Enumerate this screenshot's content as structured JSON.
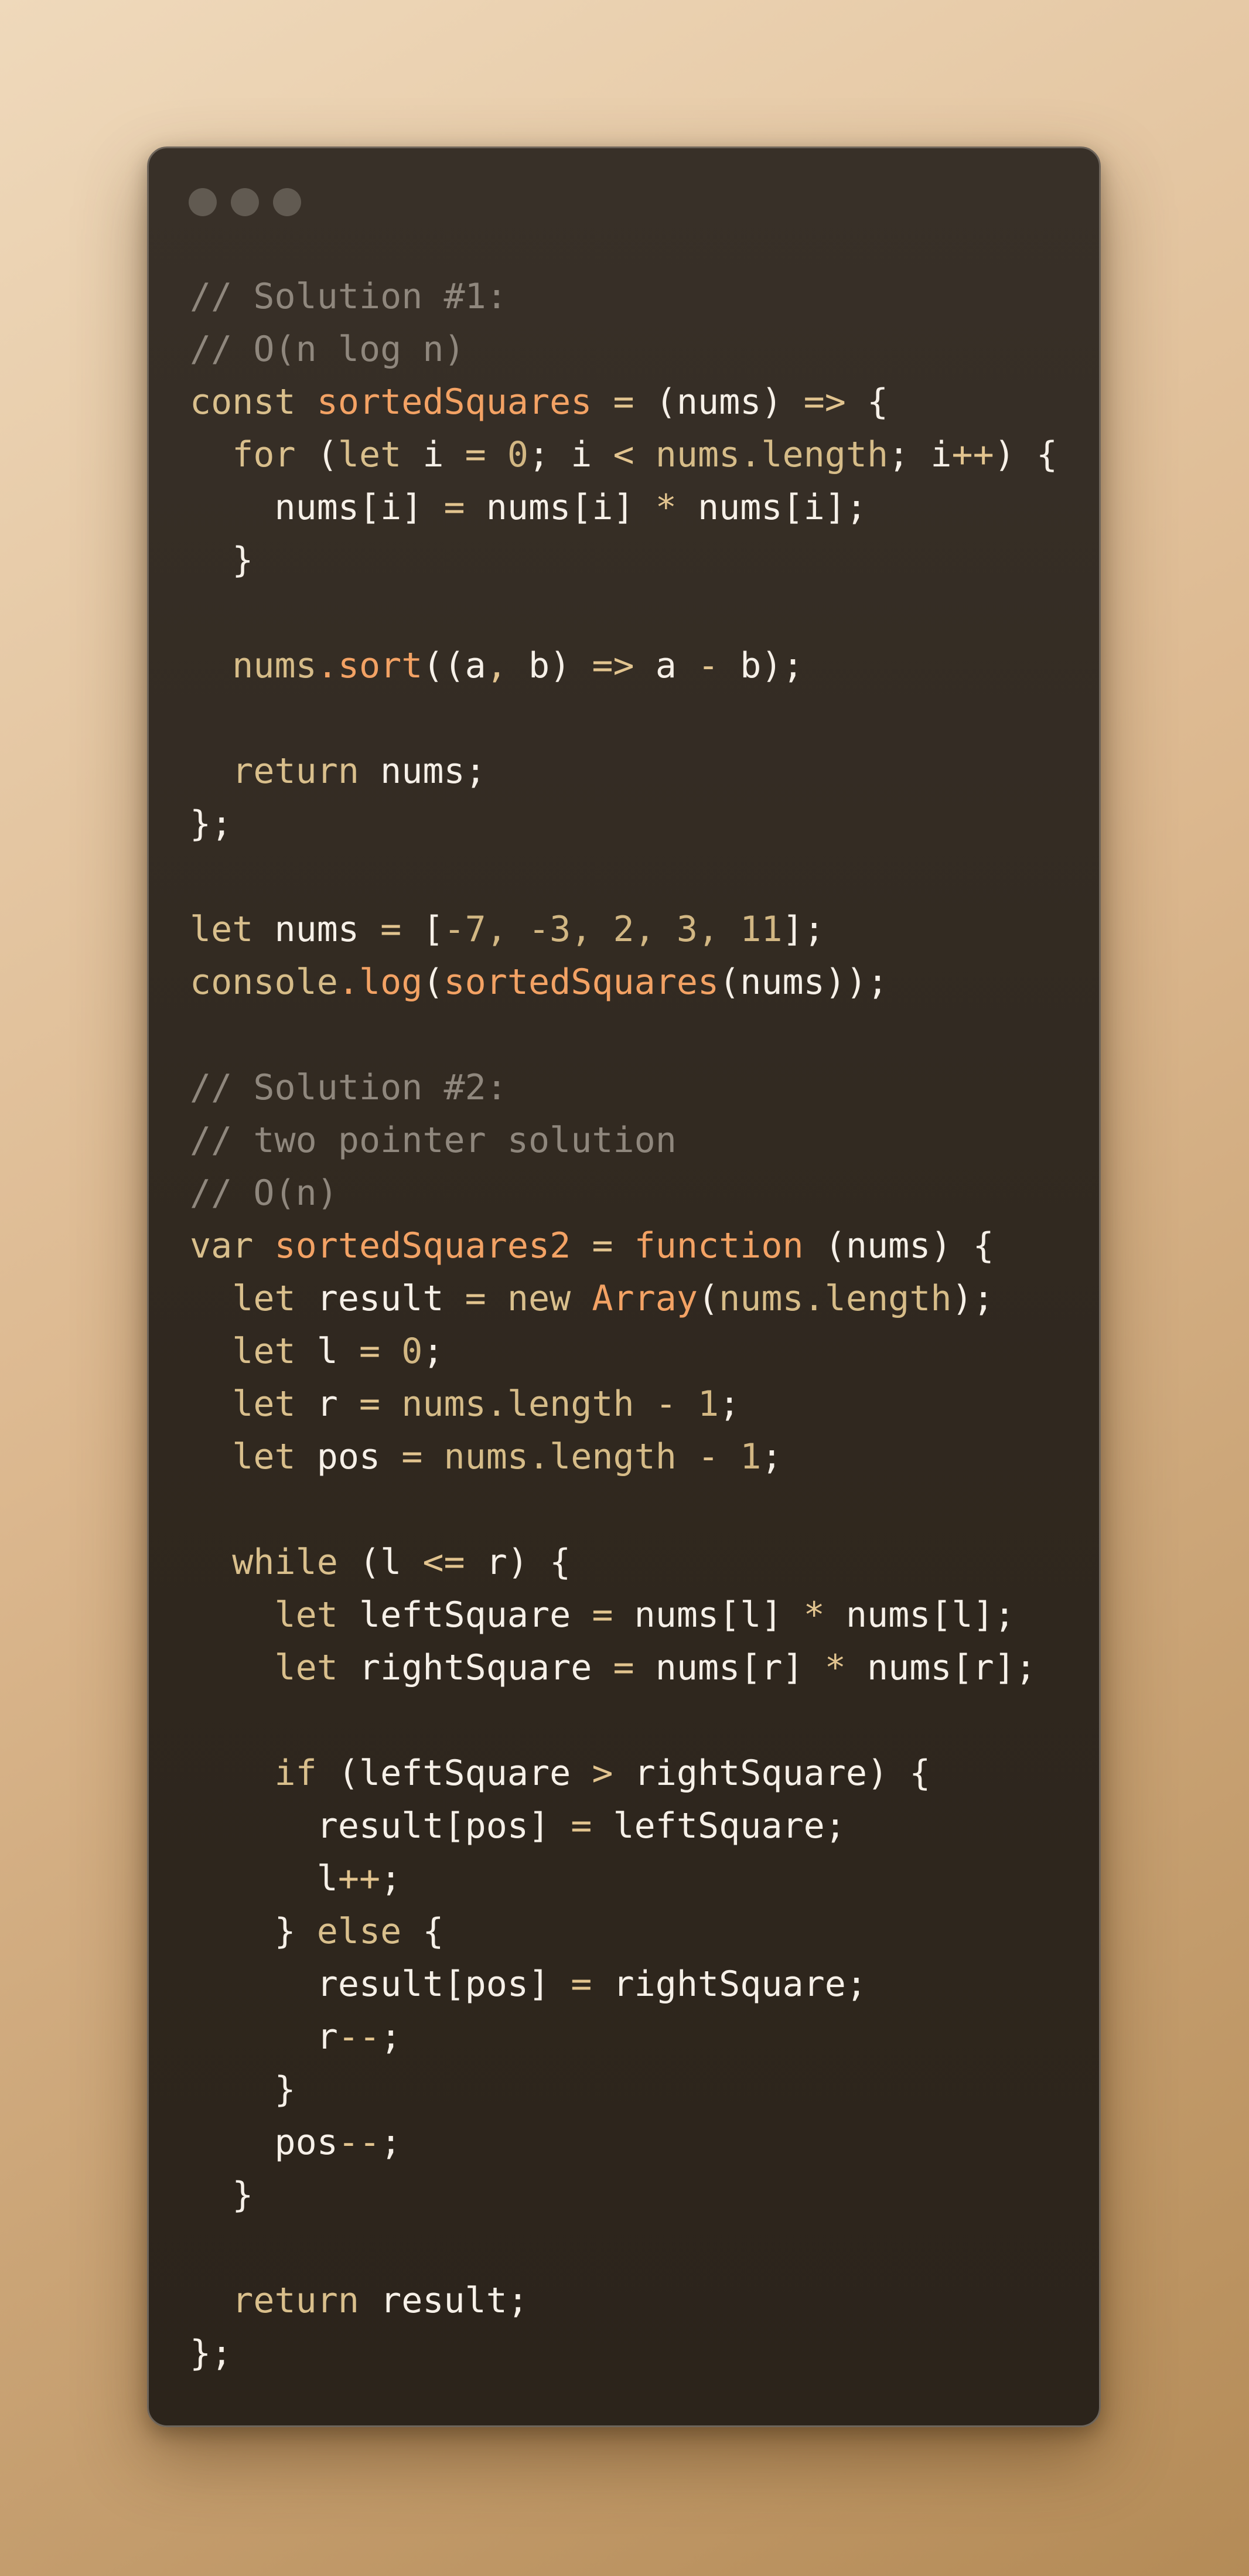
{
  "window": {
    "controls": [
      "close-dot",
      "minimize-dot",
      "maximize-dot"
    ]
  },
  "code": {
    "language": "javascript",
    "lines": [
      [
        [
          "com",
          "// Solution #1:"
        ]
      ],
      [
        [
          "com",
          "// O(n log n)"
        ]
      ],
      [
        [
          "kw",
          "const"
        ],
        [
          "plain",
          " "
        ],
        [
          "fn",
          "sortedSquares"
        ],
        [
          "plain",
          " "
        ],
        [
          "op",
          "="
        ],
        [
          "plain",
          " (nums) "
        ],
        [
          "op",
          "=>"
        ],
        [
          "plain",
          " {"
        ]
      ],
      [
        [
          "plain",
          "  "
        ],
        [
          "kw",
          "for"
        ],
        [
          "plain",
          " ("
        ],
        [
          "kw",
          "let"
        ],
        [
          "plain",
          " i "
        ],
        [
          "op",
          "="
        ],
        [
          "plain",
          " "
        ],
        [
          "num",
          "0"
        ],
        [
          "plain",
          "; i "
        ],
        [
          "op",
          "<"
        ],
        [
          "plain",
          " "
        ],
        [
          "prop",
          "nums.length"
        ],
        [
          "plain",
          "; i"
        ],
        [
          "op",
          "++"
        ],
        [
          "plain",
          ") {"
        ]
      ],
      [
        [
          "plain",
          "    nums[i] "
        ],
        [
          "op",
          "="
        ],
        [
          "plain",
          " nums[i] "
        ],
        [
          "op",
          "*"
        ],
        [
          "plain",
          " nums[i];"
        ]
      ],
      [
        [
          "plain",
          "  }"
        ]
      ],
      [],
      [
        [
          "plain",
          "  "
        ],
        [
          "prop",
          "nums"
        ],
        [
          "fn",
          ".sort"
        ],
        [
          "plain",
          "((a"
        ],
        [
          "op",
          ","
        ],
        [
          "plain",
          " b) "
        ],
        [
          "op",
          "=>"
        ],
        [
          "plain",
          " a "
        ],
        [
          "op",
          "-"
        ],
        [
          "plain",
          " b);"
        ]
      ],
      [],
      [
        [
          "plain",
          "  "
        ],
        [
          "kw",
          "return"
        ],
        [
          "plain",
          " nums;"
        ]
      ],
      [
        [
          "plain",
          "};"
        ]
      ],
      [],
      [
        [
          "kw",
          "let"
        ],
        [
          "plain",
          " nums "
        ],
        [
          "op",
          "="
        ],
        [
          "plain",
          " ["
        ],
        [
          "num",
          "-7, -3, 2, 3, 11"
        ],
        [
          "plain",
          "];"
        ]
      ],
      [
        [
          "prop",
          "console"
        ],
        [
          "fn",
          ".log"
        ],
        [
          "plain",
          "("
        ],
        [
          "fn",
          "sortedSquares"
        ],
        [
          "plain",
          "(nums));"
        ]
      ],
      [],
      [
        [
          "com",
          "// Solution #2:"
        ]
      ],
      [
        [
          "com",
          "// two pointer solution"
        ]
      ],
      [
        [
          "com",
          "// O(n)"
        ]
      ],
      [
        [
          "kw",
          "var"
        ],
        [
          "plain",
          " "
        ],
        [
          "fn",
          "sortedSquares2"
        ],
        [
          "plain",
          " "
        ],
        [
          "op",
          "="
        ],
        [
          "plain",
          " "
        ],
        [
          "fn",
          "function"
        ],
        [
          "plain",
          " (nums) {"
        ]
      ],
      [
        [
          "plain",
          "  "
        ],
        [
          "kw",
          "let"
        ],
        [
          "plain",
          " result "
        ],
        [
          "op",
          "="
        ],
        [
          "plain",
          " "
        ],
        [
          "kw",
          "new"
        ],
        [
          "plain",
          " "
        ],
        [
          "fn",
          "Array"
        ],
        [
          "plain",
          "("
        ],
        [
          "prop",
          "nums.length"
        ],
        [
          "plain",
          ");"
        ]
      ],
      [
        [
          "plain",
          "  "
        ],
        [
          "kw",
          "let"
        ],
        [
          "plain",
          " l "
        ],
        [
          "op",
          "="
        ],
        [
          "plain",
          " "
        ],
        [
          "num",
          "0"
        ],
        [
          "plain",
          ";"
        ]
      ],
      [
        [
          "plain",
          "  "
        ],
        [
          "kw",
          "let"
        ],
        [
          "plain",
          " r "
        ],
        [
          "op",
          "="
        ],
        [
          "plain",
          " "
        ],
        [
          "prop",
          "nums.length"
        ],
        [
          "plain",
          " "
        ],
        [
          "op",
          "-"
        ],
        [
          "plain",
          " "
        ],
        [
          "num",
          "1"
        ],
        [
          "plain",
          ";"
        ]
      ],
      [
        [
          "plain",
          "  "
        ],
        [
          "kw",
          "let"
        ],
        [
          "plain",
          " pos "
        ],
        [
          "op",
          "="
        ],
        [
          "plain",
          " "
        ],
        [
          "prop",
          "nums.length"
        ],
        [
          "plain",
          " "
        ],
        [
          "op",
          "-"
        ],
        [
          "plain",
          " "
        ],
        [
          "num",
          "1"
        ],
        [
          "plain",
          ";"
        ]
      ],
      [],
      [
        [
          "plain",
          "  "
        ],
        [
          "kw",
          "while"
        ],
        [
          "plain",
          " (l "
        ],
        [
          "op",
          "<="
        ],
        [
          "plain",
          " r) {"
        ]
      ],
      [
        [
          "plain",
          "    "
        ],
        [
          "kw",
          "let"
        ],
        [
          "plain",
          " leftSquare "
        ],
        [
          "op",
          "="
        ],
        [
          "plain",
          " nums[l] "
        ],
        [
          "op",
          "*"
        ],
        [
          "plain",
          " nums[l];"
        ]
      ],
      [
        [
          "plain",
          "    "
        ],
        [
          "kw",
          "let"
        ],
        [
          "plain",
          " rightSquare "
        ],
        [
          "op",
          "="
        ],
        [
          "plain",
          " nums[r] "
        ],
        [
          "op",
          "*"
        ],
        [
          "plain",
          " nums[r];"
        ]
      ],
      [],
      [
        [
          "plain",
          "    "
        ],
        [
          "kw",
          "if"
        ],
        [
          "plain",
          " (leftSquare "
        ],
        [
          "op",
          ">"
        ],
        [
          "plain",
          " rightSquare) {"
        ]
      ],
      [
        [
          "plain",
          "      result[pos] "
        ],
        [
          "op",
          "="
        ],
        [
          "plain",
          " leftSquare;"
        ]
      ],
      [
        [
          "plain",
          "      l"
        ],
        [
          "op",
          "++"
        ],
        [
          "plain",
          ";"
        ]
      ],
      [
        [
          "plain",
          "    } "
        ],
        [
          "kw",
          "else"
        ],
        [
          "plain",
          " {"
        ]
      ],
      [
        [
          "plain",
          "      result[pos] "
        ],
        [
          "op",
          "="
        ],
        [
          "plain",
          " rightSquare;"
        ]
      ],
      [
        [
          "plain",
          "      r"
        ],
        [
          "op",
          "--"
        ],
        [
          "plain",
          ";"
        ]
      ],
      [
        [
          "plain",
          "    }"
        ]
      ],
      [
        [
          "plain",
          "    pos"
        ],
        [
          "op",
          "--"
        ],
        [
          "plain",
          ";"
        ]
      ],
      [
        [
          "plain",
          "  }"
        ]
      ],
      [],
      [
        [
          "plain",
          "  "
        ],
        [
          "kw",
          "return"
        ],
        [
          "plain",
          " result;"
        ]
      ],
      [
        [
          "plain",
          "};"
        ]
      ]
    ]
  },
  "colors": {
    "background_top": "#efd9bb",
    "background_bottom": "#b48b57",
    "window": "#342b22",
    "window_border": "#6e655b",
    "control_dot": "#615a51",
    "plain": "#f6f0e8",
    "comment": "#8f877d",
    "keyword": "#d9bf8c",
    "function": "#f3a264",
    "operator": "#e2c48f",
    "number": "#d2b783",
    "property": "#d6bc88"
  }
}
